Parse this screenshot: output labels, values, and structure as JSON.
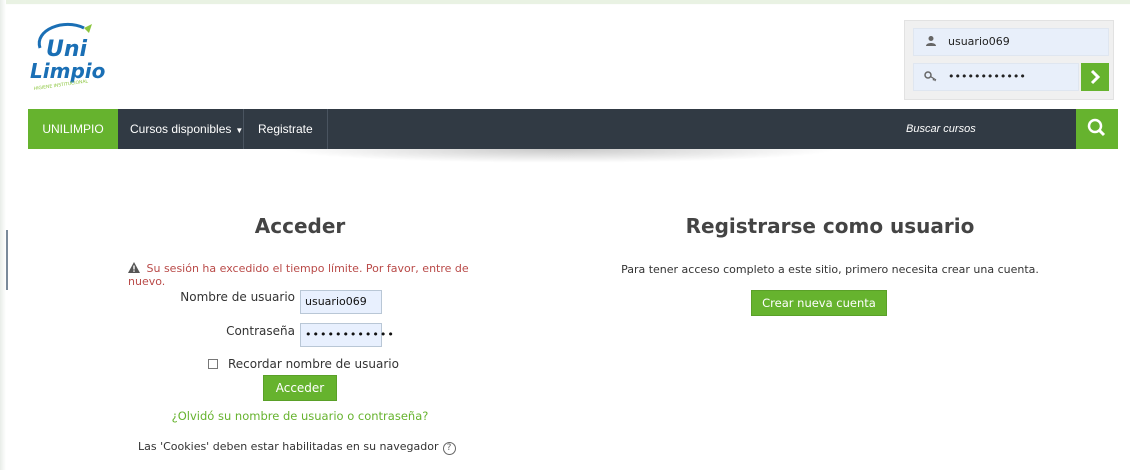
{
  "logo": {
    "line1": "Uni",
    "line2": "Limpio",
    "tagline": "HIGIENE INSTITUCIONAL"
  },
  "login_box": {
    "username_value": "usuario069",
    "password_value": "••••••••••••",
    "submit_glyph": "›"
  },
  "nav": {
    "home": "UNILIMPIO",
    "courses": "Cursos disponibles",
    "register": "Registrate",
    "search": "Buscar cursos"
  },
  "login": {
    "title": "Acceder",
    "warning": "Su sesión ha excedido el tiempo límite. Por favor, entre de nuevo.",
    "username_label": "Nombre de usuario",
    "username_value": "usuario069",
    "password_label": "Contraseña",
    "password_value": "••••••••••••",
    "remember_label": "Recordar nombre de usuario",
    "submit": "Acceder",
    "forgot": "¿Olvidó su nombre de usuario o contraseña?",
    "cookies": "Las 'Cookies' deben estar habilitadas en su navegador"
  },
  "register": {
    "title": "Registrarse como usuario",
    "description": "Para tener acceso completo a este sitio, primero necesita crear una cuenta.",
    "button": "Crear nueva cuenta"
  },
  "colors": {
    "accent": "#66b32e",
    "navbar": "#313a44",
    "warning": "#b94a48",
    "logo_blue": "#1a6fb5"
  }
}
